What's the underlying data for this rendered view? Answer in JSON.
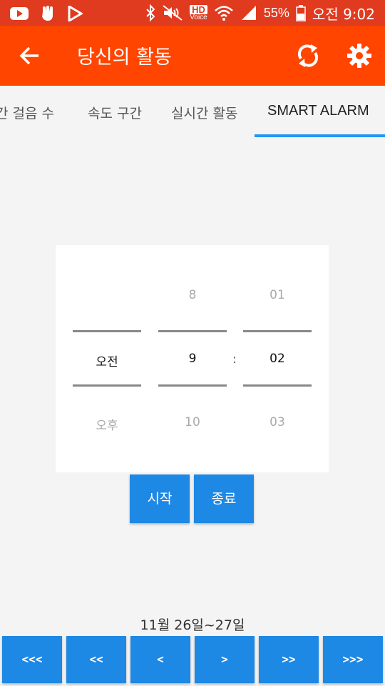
{
  "status_bar": {
    "battery": "55%",
    "time": "오전 9:02",
    "hd_label": "HD",
    "voice_label": "Voice"
  },
  "app_bar": {
    "title": "당신의 활동"
  },
  "tabs": [
    {
      "label": "간 걸음 수"
    },
    {
      "label": "속도 구간"
    },
    {
      "label": "실시간 활동"
    },
    {
      "label": "SMART ALARM"
    }
  ],
  "picker": {
    "ampm": {
      "prev": "",
      "selected": "오전",
      "next": "오후"
    },
    "hour": {
      "prev": "8",
      "selected": "9",
      "next": "10"
    },
    "separator": ":",
    "minute": {
      "prev": "01",
      "selected": "02",
      "next": "03"
    }
  },
  "buttons": {
    "start": "시작",
    "end": "종료"
  },
  "date_range": "11월 26일~27일",
  "nav": [
    "<<<",
    "<<",
    "<",
    ">",
    ">>",
    ">>>"
  ],
  "colors": {
    "status_bar": "#e03a1f",
    "app_bar": "#ff4500",
    "accent": "#1e88e5",
    "tab_indicator": "#2196f3"
  }
}
